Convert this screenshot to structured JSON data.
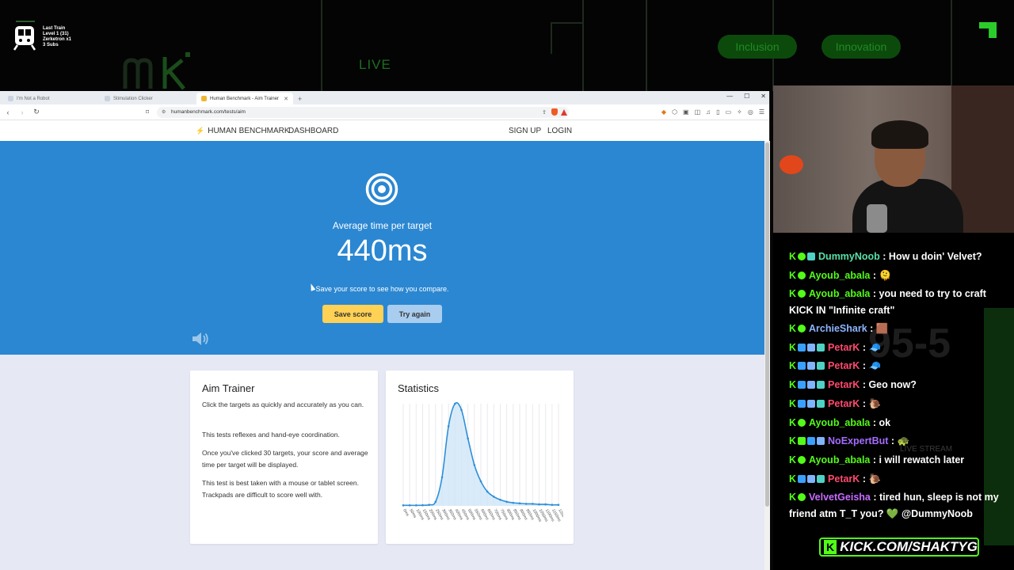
{
  "overlay": {
    "sub_goal_lines": [
      "Last Train",
      "Level 1  (31)",
      "Zerketron x1",
      "3 Subs"
    ],
    "live_label": "LIVE",
    "pills": [
      "Inclusion",
      "Innovation"
    ]
  },
  "browser": {
    "tabs": [
      {
        "label": "I'm Not a Robot",
        "active": false
      },
      {
        "label": "Stimulation Clicker",
        "active": false
      },
      {
        "label": "Human Benchmark - Aim Trainer",
        "active": true
      }
    ],
    "url": "humanbenchmark.com/tests/aim"
  },
  "site": {
    "brand": "HUMAN BENCHMARK",
    "nav_dashboard": "DASHBOARD",
    "nav_signup": "SIGN UP",
    "nav_login": "LOGIN"
  },
  "hero": {
    "avg_label": "Average time per target",
    "score": "440ms",
    "compare_text": "Save your score to see how you compare.",
    "save_button": "Save score",
    "try_button": "Try again"
  },
  "about": {
    "title": "Aim Trainer",
    "paragraphs": [
      "Click the targets as quickly and accurately as you can.",
      "This tests reflexes and hand-eye coordination.",
      "Once you've clicked 30 targets, your score and average time per target will be displayed.",
      "This test is best taken with a mouse or tablet screen. Trackpads are difficult to score well with."
    ]
  },
  "stats": {
    "title": "Statistics"
  },
  "chart_data": {
    "type": "area",
    "title": "",
    "xlabel": "",
    "ylabel": "",
    "x": [
      "0ms",
      "50ms",
      "100ms",
      "150ms",
      "200ms",
      "250ms",
      "300ms",
      "350ms",
      "400ms",
      "450ms",
      "500ms",
      "550ms",
      "600ms",
      "650ms",
      "700ms",
      "750ms",
      "800ms",
      "850ms",
      "900ms",
      "950ms",
      "1000ms",
      "1050ms",
      "1100ms",
      "1150ms",
      "1200ms"
    ],
    "series": [
      {
        "values": [
          0.5,
          0.5,
          0.5,
          0.6,
          1,
          4,
          28,
          78,
          100,
          94,
          66,
          40,
          24,
          14,
          9,
          6,
          4,
          3,
          2.5,
          2,
          2,
          1.5,
          1.5,
          1,
          1
        ]
      }
    ],
    "ylim": [
      0,
      100
    ],
    "grid": true,
    "colors": {
      "line": "#2e8fd8",
      "fill": "#cfe6f7",
      "grid": "#e8eaf0"
    }
  },
  "chat": {
    "messages": [
      {
        "badges": [
          "k",
          "sparkle",
          "grid"
        ],
        "user": "DummyNoob",
        "color": "#58e0a8",
        "text": ": How u doin' Velvet?"
      },
      {
        "badges": [
          "k",
          "sparkle"
        ],
        "user": "Ayoub_abala",
        "color": "#53fc18",
        "text": ": 🫠"
      },
      {
        "badges": [
          "k",
          "sparkle"
        ],
        "user": "Ayoub_abala",
        "color": "#53fc18",
        "text": ": you need to try to craft KICK IN \"Infinite craft\""
      },
      {
        "badges": [
          "k",
          "sparkle"
        ],
        "user": "ArchieShark",
        "color": "#8db4ff",
        "text": ": 🟫"
      },
      {
        "badges": [
          "k",
          "arrow",
          "shark",
          "grid"
        ],
        "user": "PetarK",
        "color": "#ff4a6e",
        "text": ": 🧢"
      },
      {
        "badges": [
          "k",
          "arrow",
          "shark",
          "grid"
        ],
        "user": "PetarK",
        "color": "#ff4a6e",
        "text": ": 🧢"
      },
      {
        "badges": [
          "k",
          "arrow",
          "shark",
          "grid"
        ],
        "user": "PetarK",
        "color": "#ff4a6e",
        "text": ": Geo now?"
      },
      {
        "badges": [
          "k",
          "arrow",
          "shark",
          "grid"
        ],
        "user": "PetarK",
        "color": "#ff4a6e",
        "text": ": 🐌"
      },
      {
        "badges": [
          "k",
          "sparkle"
        ],
        "user": "Ayoub_abala",
        "color": "#53fc18",
        "text": ": ok"
      },
      {
        "badges": [
          "k",
          "check",
          "cube",
          "shark"
        ],
        "user": "NoExpertBut",
        "color": "#a46bff",
        "text": ": 🐢"
      },
      {
        "badges": [
          "k",
          "sparkle"
        ],
        "user": "Ayoub_abala",
        "color": "#53fc18",
        "text": ": i will rewatch later"
      },
      {
        "badges": [
          "k",
          "arrow",
          "shark",
          "grid"
        ],
        "user": "PetarK",
        "color": "#ff4a6e",
        "text": ": 🐌"
      },
      {
        "badges": [
          "k",
          "sparkle"
        ],
        "user": "VelvetGeisha",
        "color": "#c76cff",
        "text": ": tired hun, sleep is not my friend atm T_T you? 💚 @DummyNoob"
      }
    ],
    "bg_score": "95-5",
    "bg_live": "LIVE STREAM"
  },
  "kick_banner": "KICK.COM/SHAKTYG"
}
